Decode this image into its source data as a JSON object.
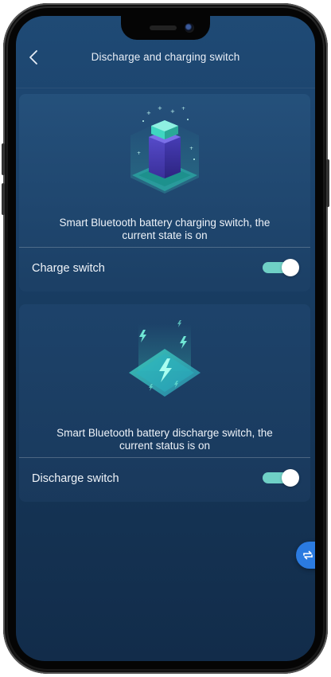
{
  "header": {
    "title": "Discharge and charging switch",
    "back_icon": "chevron-left-icon"
  },
  "charge_card": {
    "illustration": "battery-charging-icon",
    "description_line1": "Smart Bluetooth battery charging switch, the",
    "description_line2": "current state is on",
    "switch_label": "Charge switch",
    "switch_on": true
  },
  "discharge_card": {
    "illustration": "lightning-discharge-icon",
    "description_line1": "Smart Bluetooth battery discharge switch, the",
    "description_line2": "current status is on",
    "switch_label": "Discharge switch",
    "switch_on": true
  },
  "float_button": {
    "icon": "swap-arrows-icon"
  },
  "colors": {
    "background_top": "#1f4a75",
    "background_bottom": "#122c4a",
    "toggle_on": "#6fd0c6",
    "float_button": "#2b7be0",
    "illustration_accent": "#3fd6c1",
    "battery_purple": "#4b3fb0"
  }
}
